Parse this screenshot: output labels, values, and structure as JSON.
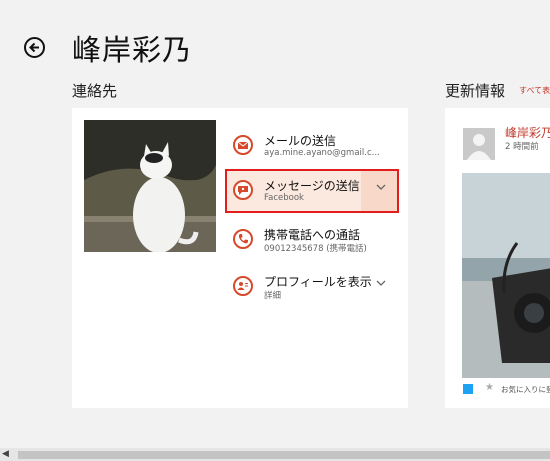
{
  "header": {
    "title": "峰岸彩乃"
  },
  "contacts": {
    "heading": "連絡先",
    "actions": [
      {
        "label": "メールの送信",
        "sub": "aya.mine.ayano@gmail.c...",
        "icon": "mail-icon",
        "selected": false,
        "has_chevron": false
      },
      {
        "label": "メッセージの送信",
        "sub": "Facebook",
        "icon": "message-icon",
        "selected": true,
        "has_chevron": true
      },
      {
        "label": "携帯電話への通話",
        "sub": "09012345678 (携帯電話)",
        "icon": "phone-icon",
        "selected": false,
        "has_chevron": false
      },
      {
        "label": "プロフィールを表示",
        "sub": "詳細",
        "icon": "profile-icon",
        "selected": false,
        "has_chevron": true
      }
    ]
  },
  "updates": {
    "heading": "更新情報",
    "see_all": "すべて表",
    "post": {
      "name": "峰岸彩乃",
      "time": "2 時間前",
      "footer": "お気に入りに登"
    }
  },
  "colors": {
    "accent": "#d6492a",
    "highlight_border": "#e31c1c",
    "link": "#c0392b"
  }
}
